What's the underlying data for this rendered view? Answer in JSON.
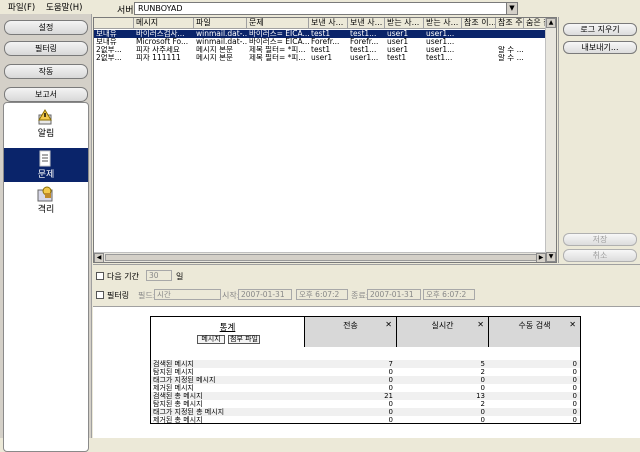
{
  "menubar": {
    "file": "파일(F)",
    "help": "도움말(H)"
  },
  "sidebar": {
    "buttons": [
      "설정",
      "필터링",
      "작동",
      "보고서"
    ],
    "nav": [
      {
        "label": "알림",
        "icon": "alert-icon"
      },
      {
        "label": "문제",
        "icon": "issue-icon"
      },
      {
        "label": "격리",
        "icon": "quarantine-icon"
      }
    ]
  },
  "server": {
    "label": "서버",
    "value": "RUNBOYAD"
  },
  "list": {
    "columns": [
      "",
      "메시지",
      "파일",
      "문제",
      "보낸 사...",
      "보낸 사...",
      "받는 사...",
      "받는 사...",
      "참조 이...",
      "참조 주...",
      "숨은 참"
    ],
    "rows": [
      [
        "보내유",
        "바이러스검사...",
        "winmail.dat-...",
        "바이러스= EICA...",
        "test1",
        "test1...",
        "user1",
        "user1...",
        "",
        "",
        ""
      ],
      [
        "보내유",
        "Microsoft Fo...",
        "winmail.dat-...",
        "바이러스= EICA...",
        "Forefr...",
        "Forefr...",
        "user1",
        "user1...",
        "",
        "",
        ""
      ],
      [
        "2없부...",
        "피자 사주세요",
        "메시지 본문",
        "제목 필터= *피...",
        "test1",
        "test1...",
        "user1",
        "user1...",
        "",
        "알 수 ...",
        ""
      ],
      [
        "2없부...",
        "피자 111111",
        "메시지 본문",
        "제목 필터= *피...",
        "user1",
        "user1...",
        "test1",
        "test1...",
        "",
        "알 수 ...",
        ""
      ]
    ]
  },
  "right_panel": {
    "clear_log": "로그 지우기",
    "export": "내보내기...",
    "save": "저장",
    "cancel": "취소"
  },
  "filters": {
    "next_period_label": "다음 기간",
    "period_value": "30",
    "period_unit": "일",
    "filter_label": "필터링",
    "field_label": "필드:",
    "field_value": "시간",
    "start_label": "시작:",
    "start_date": "2007-01-31",
    "start_time": "오후 6:07:2",
    "end_label": "종료:",
    "end_date": "2007-01-31",
    "end_time": "오후 6:07:2"
  },
  "stats": {
    "title": "통계",
    "message_button": "메시지",
    "attachment_button": "첨부 파일",
    "columns": [
      "전송",
      "실시간",
      "수동 검색"
    ],
    "rows": [
      {
        "label": "검색된 메시지",
        "values": [
          "7",
          "5",
          "0"
        ]
      },
      {
        "label": "탐지된 메시지",
        "values": [
          "0",
          "2",
          "0"
        ]
      },
      {
        "label": "태그가 지정된 메시지",
        "values": [
          "0",
          "0",
          "0"
        ]
      },
      {
        "label": "제거된 메시지",
        "values": [
          "0",
          "0",
          "0"
        ]
      },
      {
        "label": "검색된 총 메시지",
        "values": [
          "21",
          "13",
          "0"
        ]
      },
      {
        "label": "탐지된 총 메시지",
        "values": [
          "0",
          "2",
          "0"
        ]
      },
      {
        "label": "태그가 지정된 총 메시지",
        "values": [
          "0",
          "0",
          "0"
        ]
      },
      {
        "label": "제거된 총 메시지",
        "values": [
          "0",
          "0",
          "0"
        ]
      }
    ]
  },
  "colors": {
    "selection": "#0a246a",
    "panel": "#ece9d8"
  }
}
